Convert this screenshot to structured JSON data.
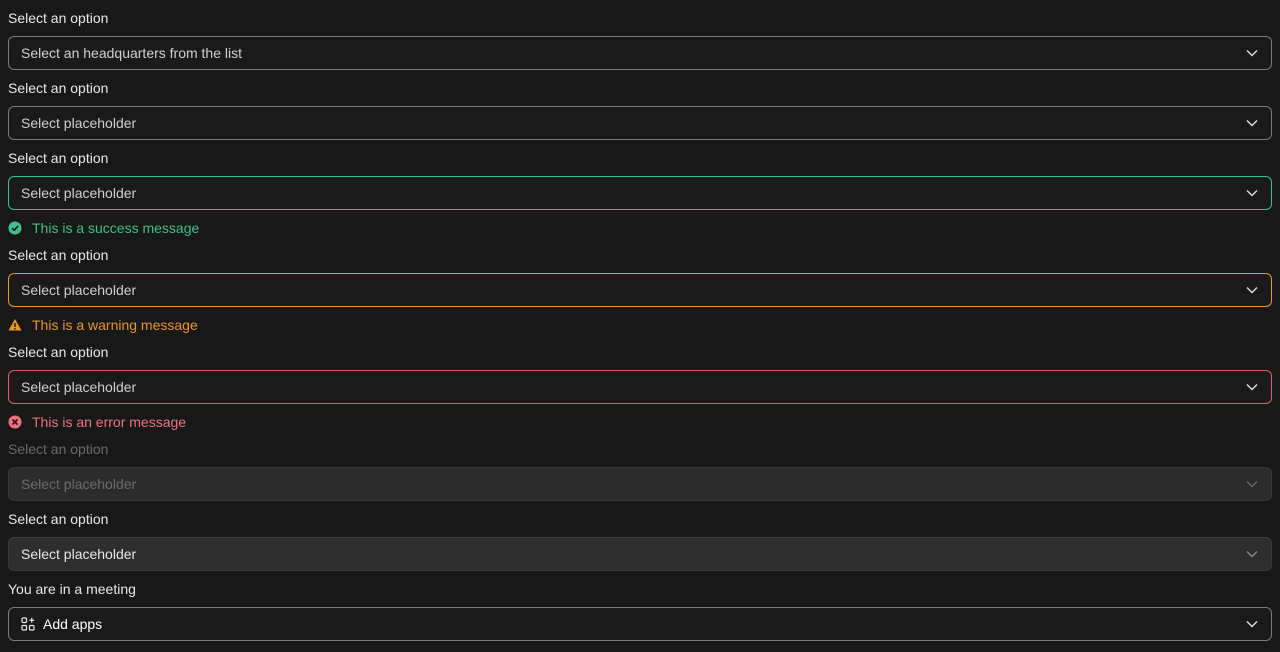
{
  "fields": [
    {
      "label": "Select an option",
      "value": "Select an headquarters from the list"
    },
    {
      "label": "Select an option",
      "value": "Select placeholder"
    },
    {
      "label": "Select an option",
      "value": "Select placeholder",
      "message": "This is a success message"
    },
    {
      "label": "Select an option",
      "value": "Select placeholder",
      "message": "This is a warning message"
    },
    {
      "label": "Select an option",
      "value": "Select placeholder",
      "message": "This is an error message"
    },
    {
      "label": "Select an option",
      "value": "Select placeholder"
    },
    {
      "label": "Select an option",
      "value": "Select placeholder"
    },
    {
      "label": "You are in a meeting",
      "value": "Add apps"
    }
  ],
  "colors": {
    "success": "#3fbf8a",
    "warning": "#e8952a",
    "error": "#e25a6a",
    "background": "#181818"
  },
  "icons": {
    "chevron": "chevron-down-icon",
    "success": "check-circle-icon",
    "warning": "warning-triangle-icon",
    "error": "x-circle-icon",
    "apps": "add-apps-icon"
  }
}
